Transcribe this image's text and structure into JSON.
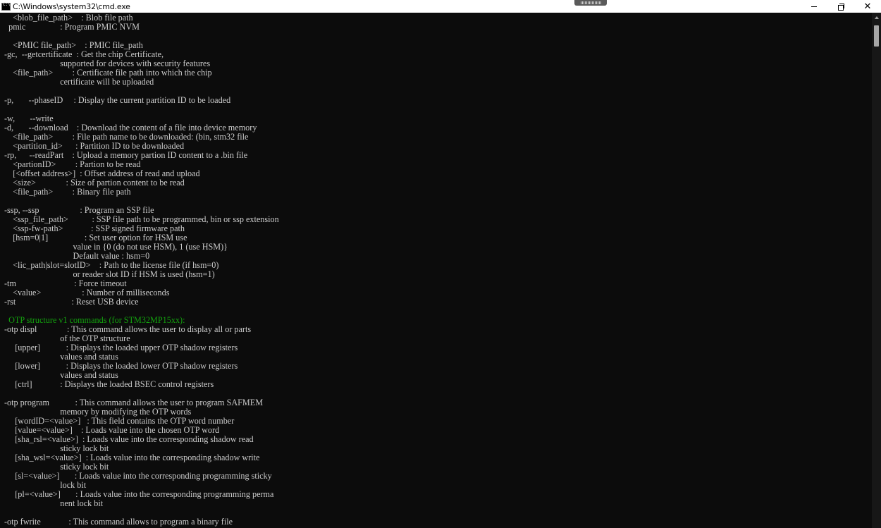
{
  "window": {
    "title": "C:\\Windows\\system32\\cmd.exe",
    "icon": "cmd-icon",
    "controls": {
      "minimize": "minimize-icon",
      "maximize": "restore-icon",
      "close": "close-icon"
    }
  },
  "colors": {
    "background": "#0c0c0c",
    "text": "#cccccc",
    "heading": "#13a10e"
  },
  "console": {
    "lines": [
      "    <blob_file_path>    : Blob file path",
      "  pmic                : Program PMIC NVM",
      "",
      "    <PMIC file_path>    : PMIC file_path",
      "-gc,  --getcertificate  : Get the chip Certificate,",
      "                          supported for devices with security features",
      "    <file_path>         : Certificate file path into which the chip",
      "                          certificate will be uploaded",
      "",
      "-p,       --phaseID     : Display the current partition ID to be loaded",
      "",
      "-w,       --write",
      "-d,       --download    : Download the content of a file into device memory",
      "    <file_path>         : File path name to be downloaded: (bin, stm32 file",
      "    <partition_id>      : Partition ID to be downloaded",
      "-rp,      --readPart    : Upload a memory partion ID content to a .bin file",
      "    <partionID>         : Partion to be read",
      "    [<offset address>]  : Offset address of read and upload",
      "    <size>              : Size of partion content to be read",
      "    <file_path>         : Binary file path",
      "",
      "-ssp, --ssp                   : Program an SSP file",
      "    <ssp_file_path>           : SSP file path to be programmed, bin or ssp extension",
      "    <ssp-fw-path>             : SSP signed firmware path",
      "    [hsm=0|1]                 : Set user option for HSM use",
      "                                value in {0 (do not use HSM), 1 (use HSM)}",
      "                                Default value : hsm=0",
      "    <lic_path|slot=slotID>    : Path to the license file (if hsm=0)",
      "                                or reader slot ID if HSM is used (hsm=1)",
      "-tm                           : Force timeout",
      "    <value>                   : Number of milliseconds",
      "-rst                          : Reset USB device",
      "",
      "  OTP structure v1 commands (for STM32MP15xx):",
      "-otp displ              : This command allows the user to display all or parts",
      "                          of the OTP structure",
      "     [upper]            : Displays the loaded upper OTP shadow registers",
      "                          values and status",
      "     [lower]            : Displays the loaded lower OTP shadow registers",
      "                          values and status",
      "     [ctrl]             : Displays the loaded BSEC control registers",
      "",
      "-otp program            : This command allows the user to program SAFMEM",
      "                          memory by modifying the OTP words",
      "     [wordID=<value>]   : This field contains the OTP word number",
      "     [value=<value>]    : Loads value into the chosen OTP word",
      "     [sha_rsl=<value>]  : Loads value into the corresponding shadow read",
      "                          sticky lock bit",
      "     [sha_wsl=<value>]  : Loads value into the corresponding shadow write",
      "                          sticky lock bit",
      "     [sl=<value>]       : Loads value into the corresponding programming sticky",
      "                          lock bit",
      "     [pl=<value>]       : Loads value into the corresponding programming perma",
      "                          nent lock bit",
      "",
      "-otp fwrite             : This command allows to program a binary file"
    ],
    "highlight_index": 33
  }
}
